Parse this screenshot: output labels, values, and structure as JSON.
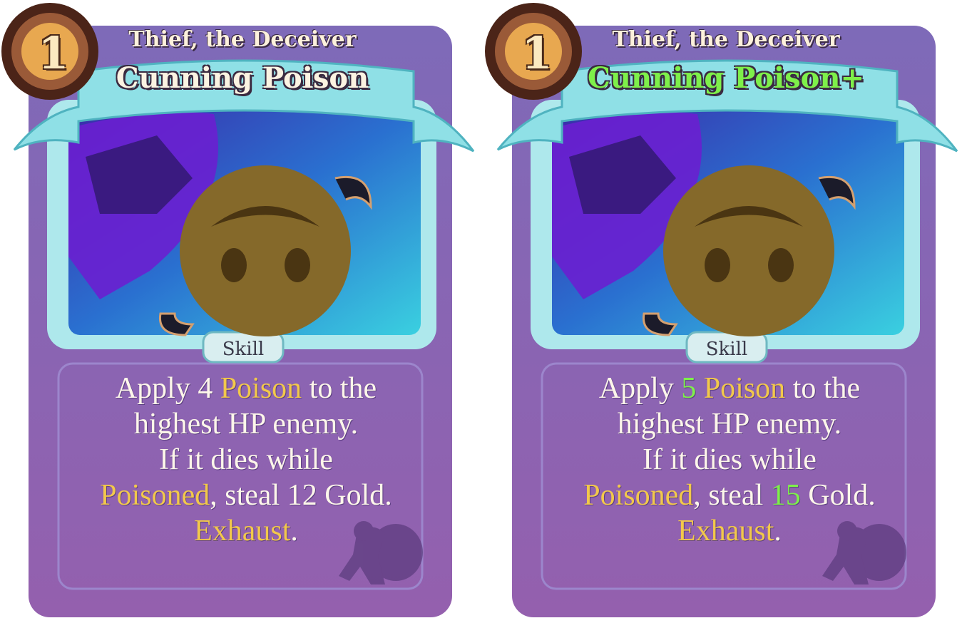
{
  "cards": [
    {
      "cost": "1",
      "character": "Thief, the Deceiver",
      "title": "Cunning Poison",
      "type": "Skill",
      "line1": {
        "a": "Apply 4 ",
        "b": "Poison",
        "c": " to the"
      },
      "line2": "highest HP enemy.",
      "line3": "If it dies while",
      "line4": {
        "a": "Poisoned",
        "b": ", steal 12 Gold."
      },
      "line5": {
        "a": "Exhaust",
        "b": "."
      }
    },
    {
      "cost": "1",
      "character": "Thief, the Deceiver",
      "title": "Cunning Poison+",
      "type": "Skill",
      "line1": {
        "a": "Apply ",
        "num": "5",
        "b": " Poison",
        "c": " to the"
      },
      "line2": "highest HP enemy.",
      "line3": "If it dies while",
      "line4": {
        "a": "Poisoned",
        "b": ", steal ",
        "num": "15",
        "c": " Gold."
      },
      "line5": {
        "a": "Exhaust",
        "b": "."
      }
    }
  ],
  "colors": {
    "card_bg": "#8a64b8",
    "keyword": "#f2c84b",
    "upgraded": "#7ef04a",
    "ribbon": "#8fe0e6"
  },
  "icons": [
    "cost-orb-icon",
    "thief-class-icon",
    "smiley-face-icon"
  ]
}
